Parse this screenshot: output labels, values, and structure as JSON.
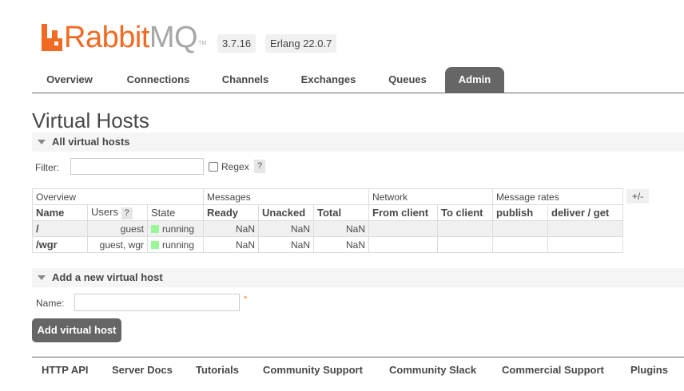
{
  "header": {
    "logo_rabbit": "Rabbit",
    "logo_mq": "MQ",
    "logo_tm": "TM",
    "version": "3.7.16",
    "erlang": "Erlang 22.0.7"
  },
  "tabs": [
    {
      "label": "Overview",
      "active": false
    },
    {
      "label": "Connections",
      "active": false
    },
    {
      "label": "Channels",
      "active": false
    },
    {
      "label": "Exchanges",
      "active": false
    },
    {
      "label": "Queues",
      "active": false
    },
    {
      "label": "Admin",
      "active": true
    }
  ],
  "page_title": "Virtual Hosts",
  "all_vhosts": {
    "section_label": "All virtual hosts",
    "filter_label": "Filter:",
    "filter_value": "",
    "regex_label": "Regex",
    "regex_help": "?",
    "plus_minus": "+/-",
    "groups": [
      "Overview",
      "Messages",
      "Network",
      "Message rates"
    ],
    "columns": [
      "Name",
      "Users",
      "State",
      "Ready",
      "Unacked",
      "Total",
      "From client",
      "To client",
      "publish",
      "deliver / get"
    ],
    "users_help": "?",
    "rows": [
      {
        "name": "/",
        "users": "guest",
        "state": "running",
        "ready": "NaN",
        "unacked": "NaN",
        "total": "NaN",
        "from_client": "",
        "to_client": "",
        "publish": "",
        "deliver_get": ""
      },
      {
        "name": "/wgr",
        "users": "guest, wgr",
        "state": "running",
        "ready": "NaN",
        "unacked": "NaN",
        "total": "NaN",
        "from_client": "",
        "to_client": "",
        "publish": "",
        "deliver_get": ""
      }
    ]
  },
  "add_vhost": {
    "section_label": "Add a new virtual host",
    "name_label": "Name:",
    "name_value": "",
    "required_mark": "*",
    "button_label": "Add virtual host"
  },
  "footer": {
    "links": [
      "HTTP API",
      "Server Docs",
      "Tutorials",
      "Community Support",
      "Community Slack",
      "Commercial Support",
      "Plugins"
    ]
  },
  "colors": {
    "brand_orange": "#f26a21",
    "tab_active": "#666666",
    "state_running": "#98f898"
  }
}
